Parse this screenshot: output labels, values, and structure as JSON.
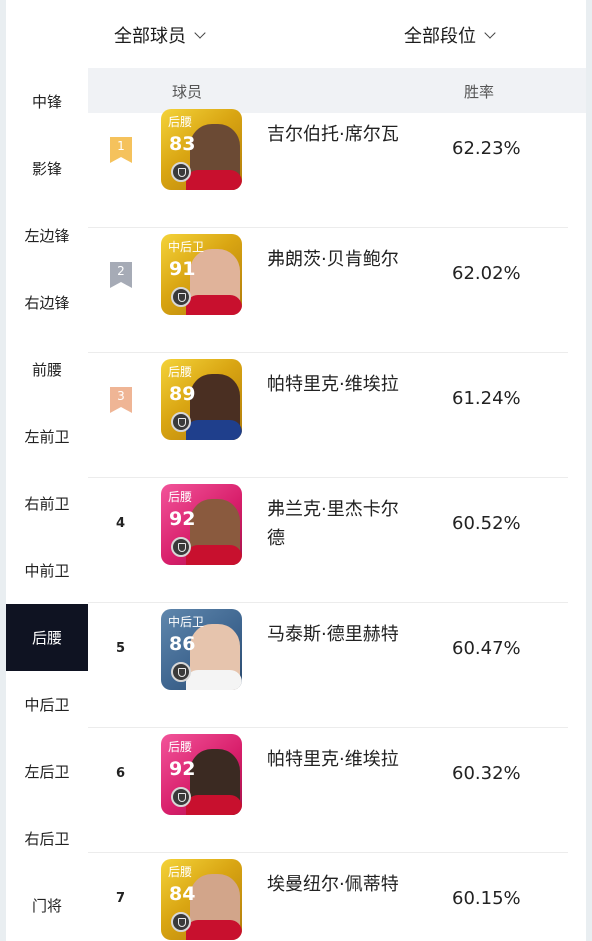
{
  "filters": {
    "players": "全部球员",
    "ranks": "全部段位"
  },
  "sidebar": {
    "items": [
      {
        "label": "中锋",
        "active": false
      },
      {
        "label": "影锋",
        "active": false
      },
      {
        "label": "左边锋",
        "active": false
      },
      {
        "label": "右边锋",
        "active": false
      },
      {
        "label": "前腰",
        "active": false
      },
      {
        "label": "左前卫",
        "active": false
      },
      {
        "label": "右前卫",
        "active": false
      },
      {
        "label": "中前卫",
        "active": false
      },
      {
        "label": "后腰",
        "active": true
      },
      {
        "label": "中后卫",
        "active": false
      },
      {
        "label": "左后卫",
        "active": false
      },
      {
        "label": "右后卫",
        "active": false
      },
      {
        "label": "门将",
        "active": false
      }
    ]
  },
  "table": {
    "headers": {
      "player": "球员",
      "winrate": "胜率"
    },
    "rows": [
      {
        "rank": "1",
        "position": "后腰",
        "rating": "83",
        "name": "吉尔伯托·席尔瓦",
        "winrate": "62.23%",
        "card": "gold",
        "badge_color": "#f5c25c"
      },
      {
        "rank": "2",
        "position": "中后卫",
        "rating": "91",
        "name": "弗朗茨·贝肯鲍尔",
        "winrate": "62.02%",
        "card": "gold",
        "badge_color": "#a6abb6"
      },
      {
        "rank": "3",
        "position": "后腰",
        "rating": "89",
        "name": "帕特里克·维埃拉",
        "winrate": "61.24%",
        "card": "gold",
        "badge_color": "#efb595"
      },
      {
        "rank": "4",
        "position": "后腰",
        "rating": "92",
        "name": "弗兰克·里杰卡尔德",
        "winrate": "60.52%",
        "card": "pink"
      },
      {
        "rank": "5",
        "position": "中后卫",
        "rating": "86",
        "name": "马泰斯·德里赫特",
        "winrate": "60.47%",
        "card": "blue"
      },
      {
        "rank": "6",
        "position": "后腰",
        "rating": "92",
        "name": "帕特里克·维埃拉",
        "winrate": "60.32%",
        "card": "pink"
      },
      {
        "rank": "7",
        "position": "后腰",
        "rating": "84",
        "name": "埃曼纽尔·佩蒂特",
        "winrate": "60.15%",
        "card": "gold"
      }
    ]
  }
}
